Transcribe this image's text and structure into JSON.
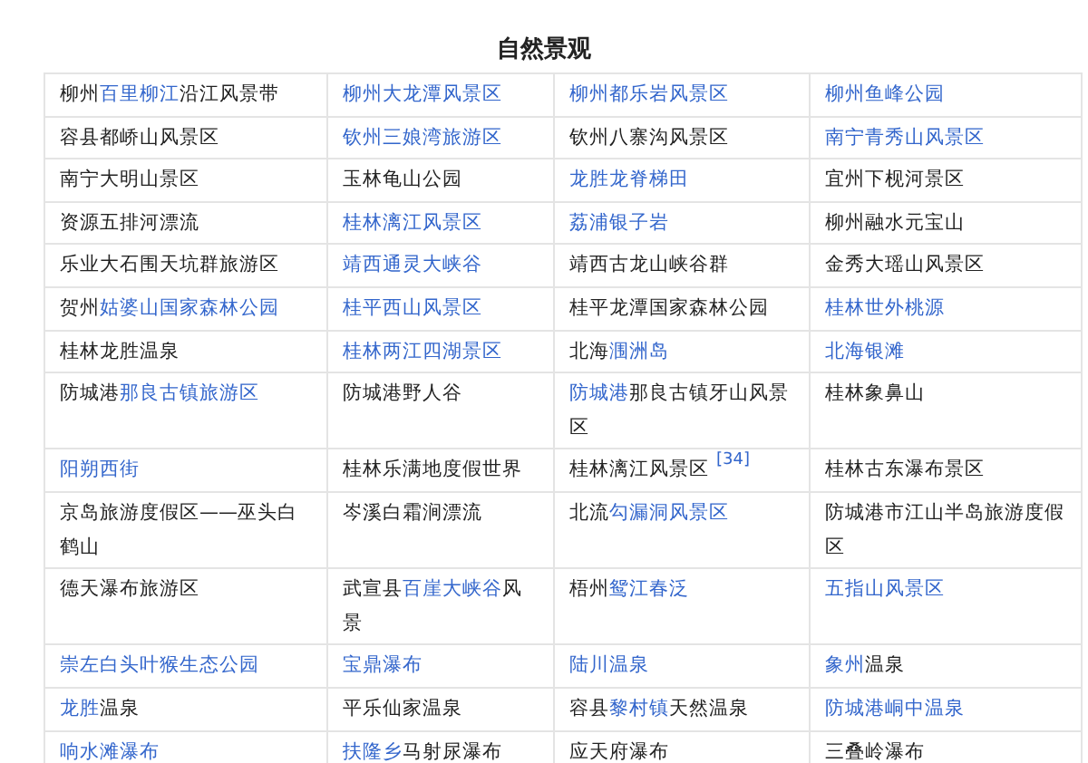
{
  "title": "自然景观",
  "table": {
    "rows": [
      [
        [
          {
            "text": "柳州",
            "link": false
          },
          {
            "text": "百里柳江",
            "link": true
          },
          {
            "text": "沿江风景带",
            "link": false
          }
        ],
        [
          {
            "text": "柳州大龙潭风景区",
            "link": true
          }
        ],
        [
          {
            "text": "柳州都乐岩风景区",
            "link": true
          }
        ],
        [
          {
            "text": "柳州鱼峰公园",
            "link": true
          }
        ]
      ],
      [
        [
          {
            "text": "容县都峤山风景区",
            "link": false
          }
        ],
        [
          {
            "text": "钦州三娘湾旅游区",
            "link": true
          }
        ],
        [
          {
            "text": "钦州八寨沟风景区",
            "link": false
          }
        ],
        [
          {
            "text": "南宁青秀山风景区",
            "link": true
          }
        ]
      ],
      [
        [
          {
            "text": "南宁大明山景区",
            "link": false
          }
        ],
        [
          {
            "text": "玉林龟山公园",
            "link": false
          }
        ],
        [
          {
            "text": "龙胜龙脊梯田",
            "link": true
          }
        ],
        [
          {
            "text": "宜州下枧河景区",
            "link": false
          }
        ]
      ],
      [
        [
          {
            "text": "资源五排河漂流",
            "link": false
          }
        ],
        [
          {
            "text": "桂林漓江风景区",
            "link": true
          }
        ],
        [
          {
            "text": "荔浦银子岩",
            "link": true
          }
        ],
        [
          {
            "text": "柳州融水元宝山",
            "link": false
          }
        ]
      ],
      [
        [
          {
            "text": "乐业大石围天坑群旅游区",
            "link": false
          }
        ],
        [
          {
            "text": "靖西通灵大峡谷",
            "link": true
          }
        ],
        [
          {
            "text": "靖西古龙山峡谷群",
            "link": false
          }
        ],
        [
          {
            "text": "金秀大瑶山风景区",
            "link": false
          }
        ]
      ],
      [
        [
          {
            "text": "贺州",
            "link": false
          },
          {
            "text": "姑婆山国家森林公园",
            "link": true
          }
        ],
        [
          {
            "text": "桂平西山风景区",
            "link": true
          }
        ],
        [
          {
            "text": "桂平龙潭国家森林公园",
            "link": false
          }
        ],
        [
          {
            "text": "桂林世外桃源",
            "link": true
          }
        ]
      ],
      [
        [
          {
            "text": "桂林龙胜温泉",
            "link": false
          }
        ],
        [
          {
            "text": "桂林两江四湖景区",
            "link": true
          }
        ],
        [
          {
            "text": "北海",
            "link": false
          },
          {
            "text": "涠洲岛",
            "link": true
          }
        ],
        [
          {
            "text": "北海银滩",
            "link": true
          }
        ]
      ],
      [
        [
          {
            "text": "防城港",
            "link": false
          },
          {
            "text": "那良古镇旅游区",
            "link": true
          }
        ],
        [
          {
            "text": "防城港野人谷",
            "link": false
          }
        ],
        [
          {
            "text": "防城港",
            "link": true
          },
          {
            "text": "那良古镇牙山风景区",
            "link": false
          }
        ],
        [
          {
            "text": "桂林象鼻山",
            "link": false
          }
        ]
      ],
      [
        [
          {
            "text": "阳朔西街",
            "link": true
          }
        ],
        [
          {
            "text": "桂林乐满地度假世界",
            "link": false
          }
        ],
        [
          {
            "text": "桂林漓江风景区",
            "link": false
          },
          {
            "text": "[34]",
            "kind": "reference",
            "link": true
          }
        ],
        [
          {
            "text": "桂林古东瀑布景区",
            "link": false
          }
        ]
      ],
      [
        [
          {
            "text": "京岛旅游度假区——巫头白鹤山",
            "link": false
          }
        ],
        [
          {
            "text": "岑溪白霜涧漂流",
            "link": false
          }
        ],
        [
          {
            "text": "北流",
            "link": false
          },
          {
            "text": "勾漏洞风景区",
            "link": true
          }
        ],
        [
          {
            "text": "防城港市江山半岛旅游度假区",
            "link": false
          }
        ]
      ],
      [
        [
          {
            "text": "德天瀑布旅游区",
            "link": false
          }
        ],
        [
          {
            "text": "武宣县",
            "link": false
          },
          {
            "text": "百崖大峡谷",
            "link": true
          },
          {
            "text": "风景",
            "link": false
          }
        ],
        [
          {
            "text": "梧州",
            "link": false
          },
          {
            "text": "鸳江春泛",
            "link": true
          }
        ],
        [
          {
            "text": "五指山风景区",
            "link": true
          }
        ]
      ],
      [
        [
          {
            "text": "崇左白头叶猴生态公园",
            "link": true
          }
        ],
        [
          {
            "text": "宝鼎瀑布",
            "link": true
          }
        ],
        [
          {
            "text": "陆川温泉",
            "link": true
          }
        ],
        [
          {
            "text": "象州",
            "link": true
          },
          {
            "text": "温泉",
            "link": false
          }
        ]
      ],
      [
        [
          {
            "text": "龙胜",
            "link": true
          },
          {
            "text": "温泉",
            "link": false
          }
        ],
        [
          {
            "text": "平乐仙家温泉",
            "link": false
          }
        ],
        [
          {
            "text": "容县",
            "link": false
          },
          {
            "text": "黎村镇",
            "link": true
          },
          {
            "text": "天然温泉",
            "link": false
          }
        ],
        [
          {
            "text": "防城港峒中温泉",
            "link": true
          }
        ]
      ],
      [
        [
          {
            "text": "响水滩瀑布",
            "link": true
          }
        ],
        [
          {
            "text": "扶隆乡",
            "link": true
          },
          {
            "text": "马射尿瀑布",
            "link": false
          }
        ],
        [
          {
            "text": "应天府瀑布",
            "link": false
          }
        ],
        [
          {
            "text": "三叠岭瀑布",
            "link": false
          }
        ]
      ]
    ]
  }
}
